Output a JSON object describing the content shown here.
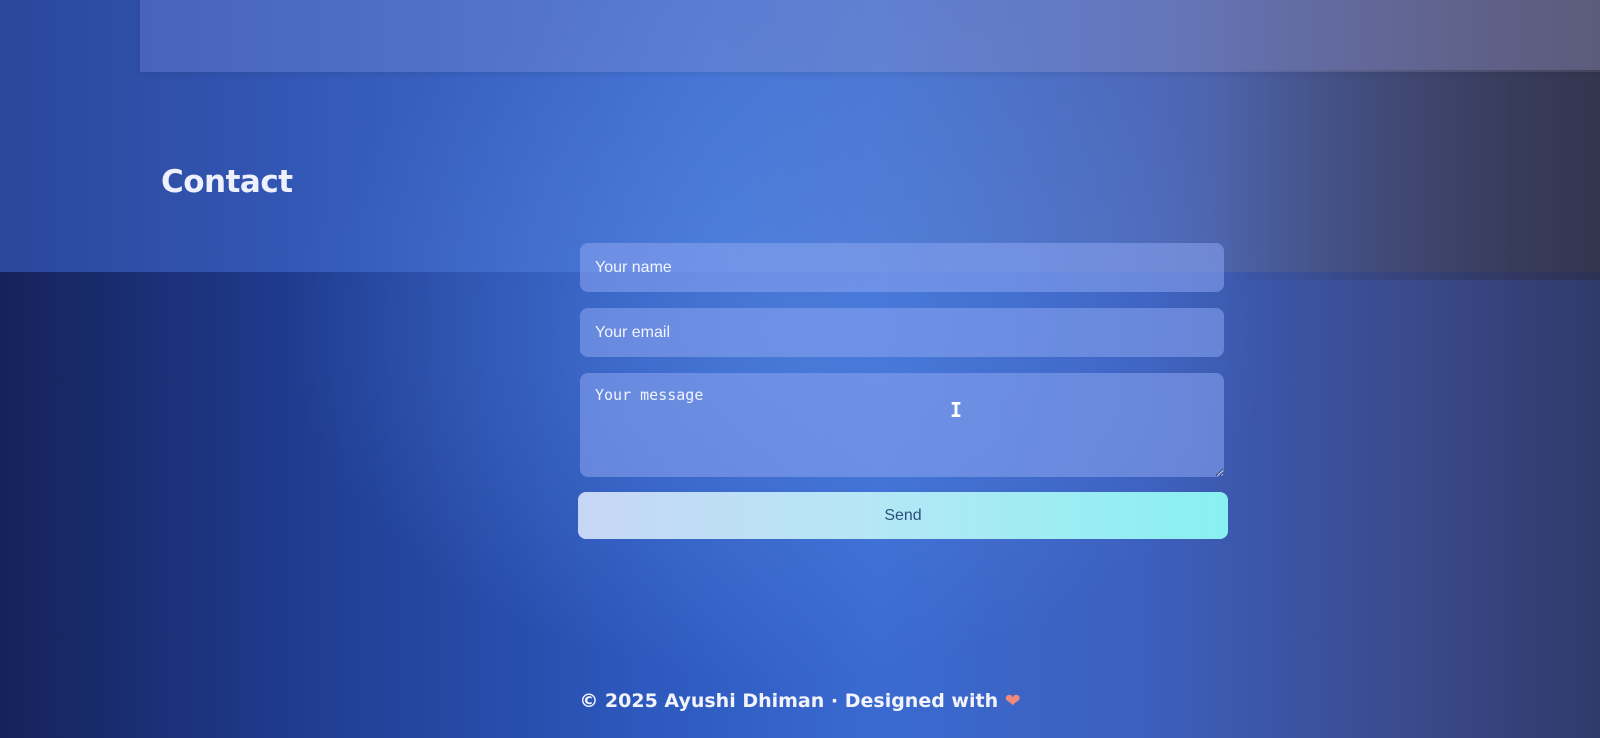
{
  "contact": {
    "title": "Contact",
    "name_placeholder": "Your name",
    "email_placeholder": "Your email",
    "message_placeholder": "Your message",
    "send_label": "Send"
  },
  "footer": {
    "text": "© 2025 Ayushi Dhiman · Designed with",
    "heart_glyph": "❤"
  },
  "icons": {
    "footer_heart": "heart-icon",
    "pointer": "text-cursor-icon"
  },
  "colors": {
    "accent_button_start": "#c7d6f6",
    "accent_button_end": "#88f0f2",
    "heart": "#f08a7a"
  }
}
